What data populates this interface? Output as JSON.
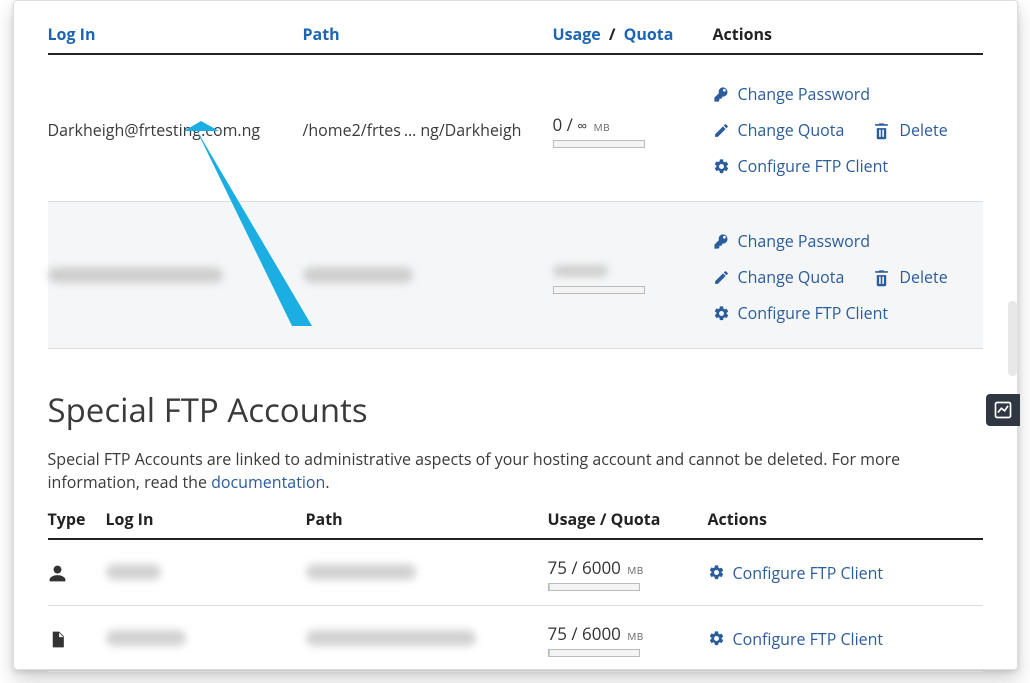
{
  "ftp_table": {
    "headers": {
      "login": "Log In",
      "path": "Path",
      "usage": "Usage",
      "quota": "Quota",
      "actions": "Actions",
      "sep": "/"
    },
    "rows": [
      {
        "login": "Darkheigh@frtesting.com.ng",
        "path_a": "/home2/frtes",
        "path_b": "ng/Darkheigh",
        "ellipsis": "…",
        "usage_val": "0",
        "quota_val": "∞",
        "mb": "MB",
        "meter_pct": 0
      },
      {
        "login": "",
        "path_a": "",
        "path_b": "",
        "ellipsis": "",
        "usage_val": "",
        "quota_val": "",
        "mb": "",
        "meter_pct": 0,
        "redacted": true
      }
    ],
    "actions": {
      "change_password": "Change Password",
      "change_quota": "Change Quota",
      "delete": "Delete",
      "configure": "Configure FTP Client"
    }
  },
  "special": {
    "title": "Special FTP Accounts",
    "desc_a": "Special FTP Accounts are linked to administrative aspects of your hosting account and cannot be deleted. For more information, read the ",
    "doc_link": "documentation",
    "desc_b": ".",
    "headers": {
      "type": "Type",
      "login": "Log In",
      "path": "Path",
      "usage": "Usage / Quota",
      "actions": "Actions"
    },
    "rows": [
      {
        "type": "user",
        "usage": "75 / 6000",
        "mb": "MB",
        "meter_pct": 2
      },
      {
        "type": "file",
        "usage": "75 / 6000",
        "mb": "MB",
        "meter_pct": 2
      }
    ],
    "configure": "Configure FTP Client"
  }
}
